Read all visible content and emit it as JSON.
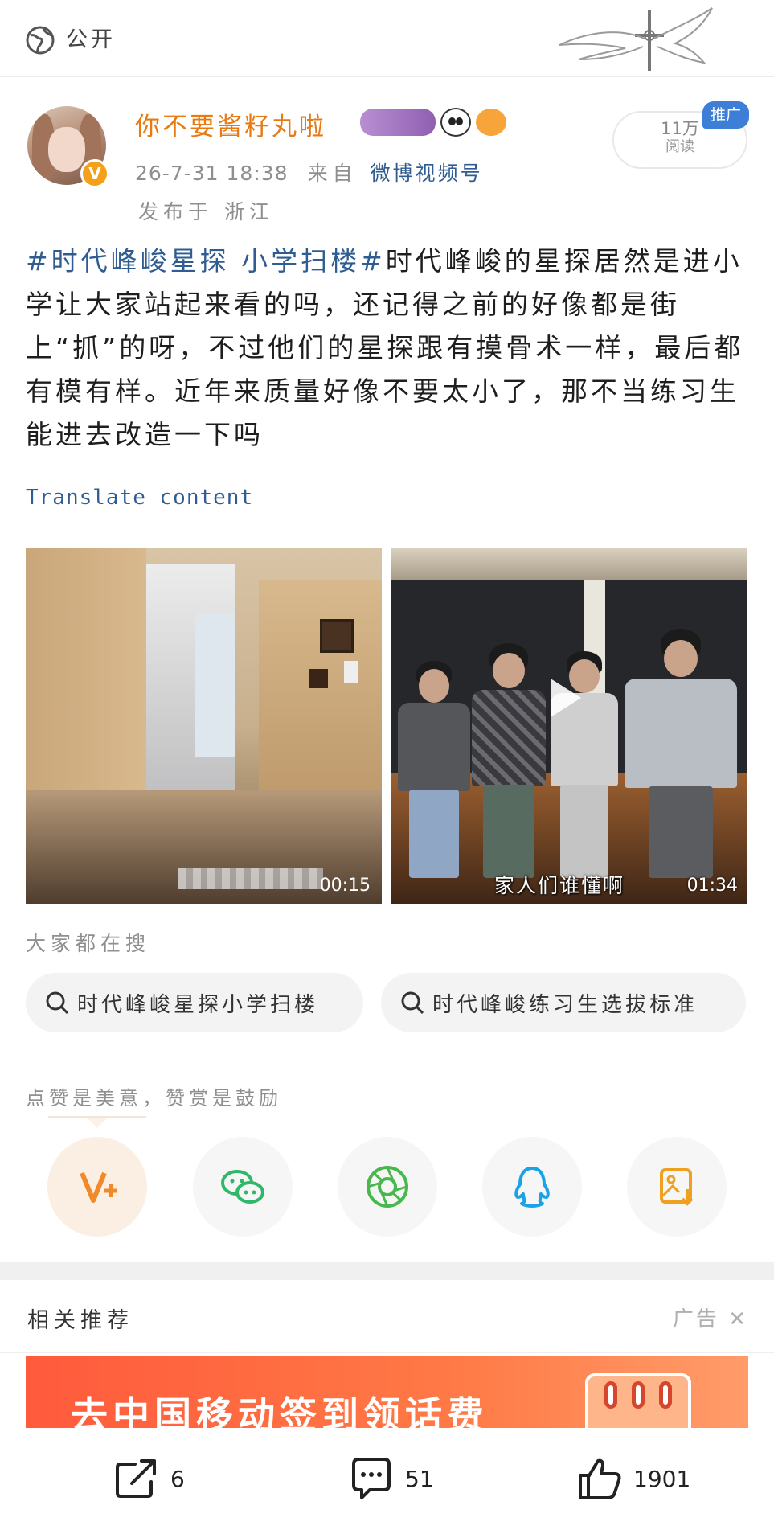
{
  "topbar": {
    "visibility": "公开",
    "globe_icon": "globe-icon"
  },
  "author": {
    "name": "你不要酱籽丸啦",
    "time": "26-7-31 18:38",
    "from_label": "来自",
    "source": "微博视频号",
    "location": "发布于 浙江",
    "verified_icon": "verified-v-icon"
  },
  "stats": {
    "reads_count": "11万",
    "reads_label": "阅读",
    "promo_tag": "推广"
  },
  "post": {
    "hashtag": "#时代峰峻星探 小学扫楼#",
    "body": "时代峰峻的星探居然是进小学让大家站起来看的吗，还记得之前的好像都是街上“抓”的呀，不过他们的星探跟有摸骨术一样，最后都有模有样。近年来质量好像不要太小了，那不当练习生能进去改造一下吗",
    "translate": "Translate content"
  },
  "media": {
    "left_video": {
      "duration": "00:15"
    },
    "right_video": {
      "subtitle": "家人们谁懂啊",
      "duration": "01:34"
    }
  },
  "search": {
    "label": "大家都在搜",
    "items": [
      "时代峰峻星探小学扫楼",
      "时代峰峻练习生选拔标准"
    ]
  },
  "reward": {
    "label": "点赞是美意，赞赏是鼓励",
    "buttons": [
      "reward-v-icon",
      "wechat-icon",
      "moments-icon",
      "qq-icon",
      "save-image-icon"
    ]
  },
  "related": {
    "title": "相关推荐",
    "ad_label": "广告",
    "close_icon": "close-icon",
    "ad_text": "去中国移动签到领话费"
  },
  "actions": {
    "repost": "6",
    "comment": "51",
    "like": "1901"
  },
  "colors": {
    "accent_orange": "#e87a12",
    "link_blue": "#2f5d92",
    "promo_blue": "#3d7fd6"
  }
}
